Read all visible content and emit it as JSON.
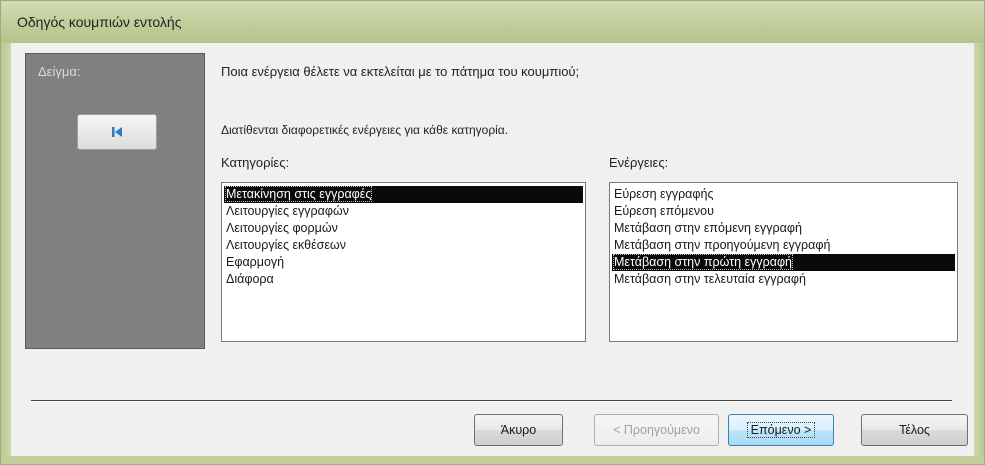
{
  "window": {
    "title": "Οδηγός κουμπιών εντολής"
  },
  "sample": {
    "label": "Δείγμα:",
    "button_icon": "goto-first-record-icon"
  },
  "prompt": {
    "question": "Ποια ενέργεια θέλετε να εκτελείται με το πάτημα του κουμπιού;",
    "subtext": "Διατίθενται διαφορετικές ενέργειες για κάθε κατηγορία."
  },
  "categories": {
    "label": "Κατηγορίες:",
    "items": [
      "Μετακίνηση στις εγγραφές",
      "Λειτουργίες εγγραφών",
      "Λειτουργίες φορμών",
      "Λειτουργίες εκθέσεων",
      "Εφαρμογή",
      "Διάφορα"
    ],
    "selected_index": 0
  },
  "actions": {
    "label": "Ενέργειες:",
    "items": [
      "Εύρεση εγγραφής",
      "Εύρεση επόμενου",
      "Μετάβαση στην επόμενη εγγραφή",
      "Μετάβαση στην προηγούμενη εγγραφή",
      "Μετάβαση στην πρώτη εγγραφή",
      "Μετάβαση στην τελευταία εγγραφή"
    ],
    "selected_index": 4
  },
  "buttons": {
    "cancel": "Άκυρο",
    "back": "< Προηγούμενο",
    "next": "Επόμενο >",
    "finish": "Τέλος"
  },
  "colors": {
    "titlebar": "#c3cf9e",
    "selection": "#0a0a0a",
    "sample_panel": "#808080",
    "icon_blue": "#2e7dc4"
  }
}
